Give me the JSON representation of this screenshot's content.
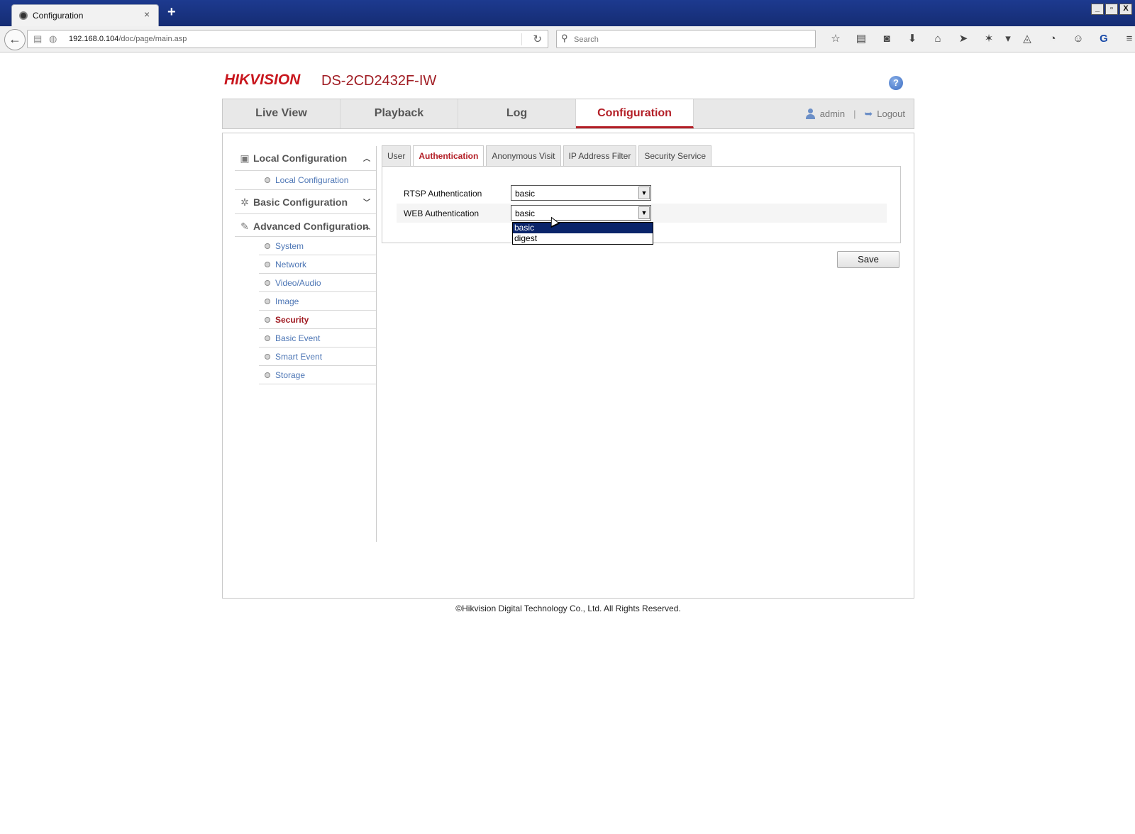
{
  "browser": {
    "tab_title": "Configuration",
    "tab_close": "×",
    "new_tab": "+",
    "window_buttons": [
      "_",
      "▫",
      "X"
    ],
    "url_host": "192.168.0.104",
    "url_path": "/doc/page/main.asp",
    "search_placeholder": "Search",
    "toolbar_icons": [
      "star-icon",
      "reader-icon",
      "pocket-icon",
      "download-icon",
      "home-icon",
      "send-icon",
      "extension-icon",
      "dropdown-icon",
      "sync-icon",
      "history-icon",
      "chat-icon",
      "translate-icon",
      "menu-icon"
    ]
  },
  "header": {
    "logo": "HIKVISION",
    "model": "DS-2CD2432F-IW",
    "help": "?"
  },
  "mainnav": {
    "tabs": [
      {
        "label": "Live View",
        "active": false
      },
      {
        "label": "Playback",
        "active": false
      },
      {
        "label": "Log",
        "active": false
      },
      {
        "label": "Configuration",
        "active": true
      }
    ],
    "user": "admin",
    "separator": "|",
    "logout": "Logout"
  },
  "sidebar": {
    "local": {
      "label": "Local Configuration",
      "items": [
        "Local Configuration"
      ]
    },
    "basic": {
      "label": "Basic Configuration"
    },
    "advanced": {
      "label": "Advanced Configuration",
      "items": [
        "System",
        "Network",
        "Video/Audio",
        "Image",
        "Security",
        "Basic Event",
        "Smart Event",
        "Storage"
      ],
      "active_item": "Security"
    }
  },
  "subtabs": [
    "User",
    "Authentication",
    "Anonymous Visit",
    "IP Address Filter",
    "Security Service"
  ],
  "active_subtab": "Authentication",
  "form": {
    "rtsp_label": "RTSP Authentication",
    "rtsp_value": "basic",
    "web_label": "WEB Authentication",
    "web_value": "basic",
    "web_options": [
      "basic",
      "digest"
    ],
    "web_highlighted": "basic"
  },
  "save_label": "Save",
  "footer": "©Hikvision Digital Technology Co., Ltd. All Rights Reserved.",
  "colors": {
    "brand_red": "#c8161d",
    "active_red": "#b31e26",
    "link_blue": "#4d76b5",
    "selection_navy": "#0a246a"
  }
}
